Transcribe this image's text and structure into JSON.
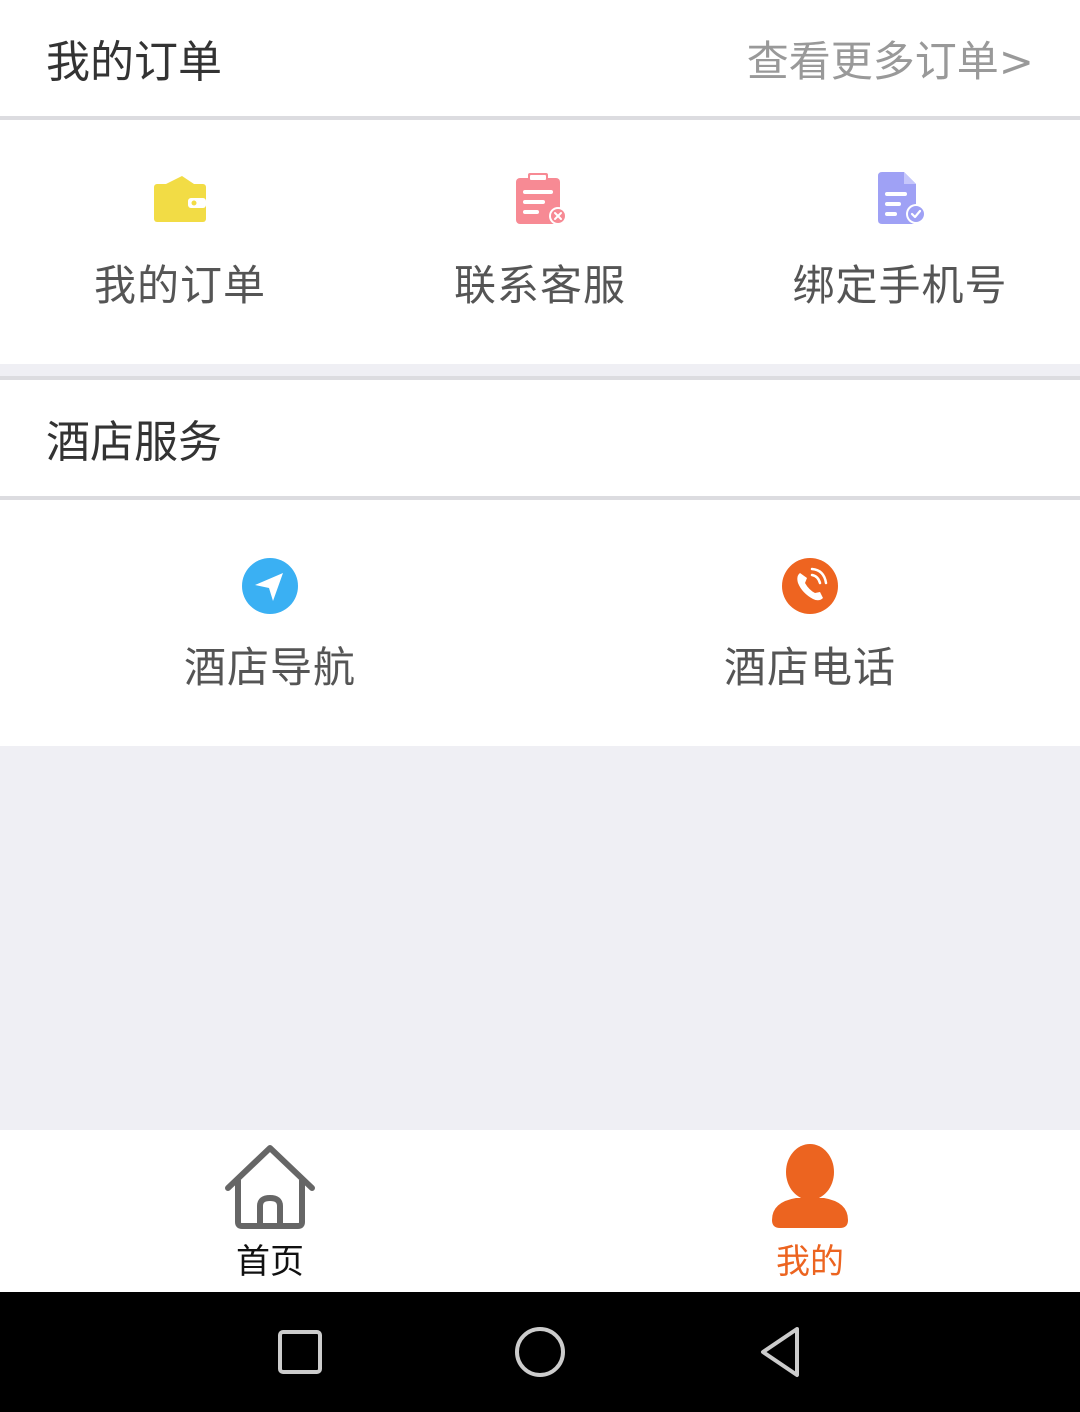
{
  "orders": {
    "title": "我的订单",
    "more_link": "查看更多订单>",
    "items": [
      {
        "label": "我的订单",
        "icon": "wallet-icon",
        "color": "#f2dc45"
      },
      {
        "label": "联系客服",
        "icon": "clipboard-icon",
        "color": "#f78a94"
      },
      {
        "label": "绑定手机号",
        "icon": "document-check-icon",
        "color": "#9fa1f5"
      }
    ]
  },
  "hotel_service": {
    "title": "酒店服务",
    "items": [
      {
        "label": "酒店导航",
        "icon": "navigation-icon",
        "color": "#3ab0f3"
      },
      {
        "label": "酒店电话",
        "icon": "phone-icon",
        "color": "#ee6420"
      }
    ]
  },
  "tabbar": {
    "tabs": [
      {
        "label": "首页",
        "icon": "home-icon",
        "active": false
      },
      {
        "label": "我的",
        "icon": "user-icon",
        "active": true
      }
    ],
    "active_color": "#ec6420"
  },
  "system_nav": {
    "buttons": [
      "recents-icon",
      "home-circle-icon",
      "back-icon"
    ]
  }
}
